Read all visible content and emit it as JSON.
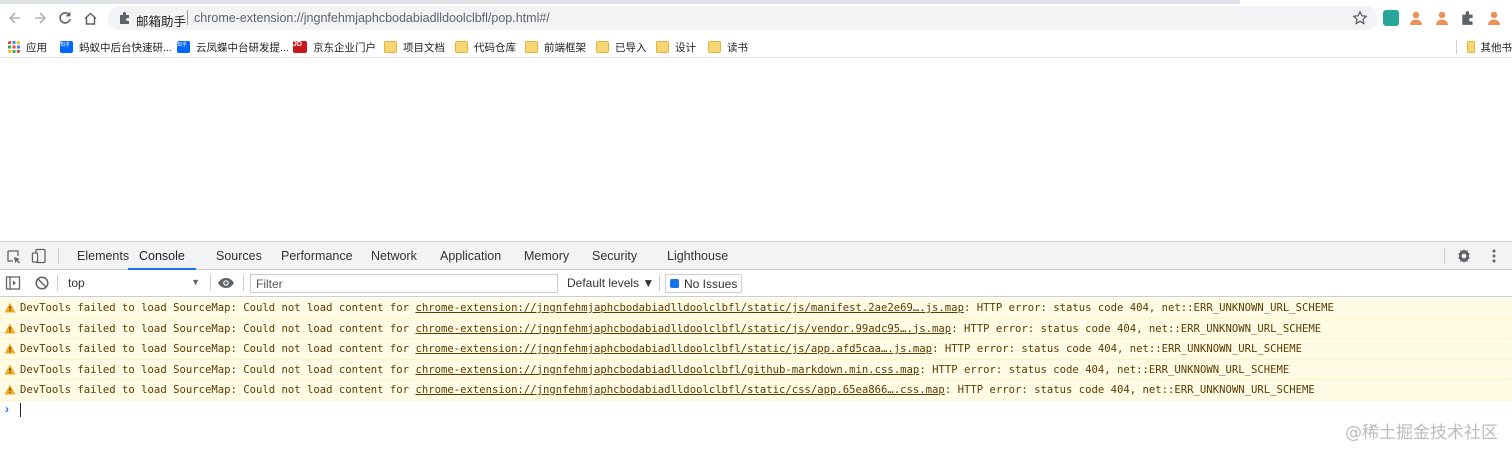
{
  "browser": {
    "site_name": "邮箱助手",
    "url": "chrome-extension://jngnfehmjaphcbodabiadlldoolclbfl/pop.html#/"
  },
  "bookmarks": [
    {
      "label": "应用",
      "icon": "apps-grid-icon"
    },
    {
      "label": "蚂蚁中后台快速研...",
      "icon": "zhihu-icon"
    },
    {
      "label": "云凤蝶中台研发提...",
      "icon": "zhihu-icon"
    },
    {
      "label": "京东企业门户",
      "icon": "jd-icon"
    },
    {
      "label": "项目文档",
      "icon": "folder-icon"
    },
    {
      "label": "代码仓库",
      "icon": "folder-icon"
    },
    {
      "label": "前端框架",
      "icon": "folder-icon"
    },
    {
      "label": "已导入",
      "icon": "folder-icon"
    },
    {
      "label": "设计",
      "icon": "folder-icon"
    },
    {
      "label": "读书",
      "icon": "folder-icon"
    },
    {
      "label": "其他书",
      "icon": "folder-icon"
    }
  ],
  "favicon_badges": {
    "zhihu": "知乎",
    "jd": "JD"
  },
  "devtools": {
    "tabs": [
      "Elements",
      "Console",
      "Sources",
      "Performance",
      "Network",
      "Application",
      "Memory",
      "Security",
      "Lighthouse"
    ],
    "active_tab": "Console",
    "context": "top",
    "filter_placeholder": "Filter",
    "levels_label": "Default levels ▼",
    "issues_label": "No Issues",
    "messages": [
      {
        "prefix": "DevTools failed to load SourceMap: Could not load content for ",
        "link": "chrome-extension://jngnfehmjaphcbodabiadlldoolclbfl/static/js/manifest.2ae2e69….js.map",
        "suffix": ": HTTP error: status code 404, net::ERR_UNKNOWN_URL_SCHEME"
      },
      {
        "prefix": "DevTools failed to load SourceMap: Could not load content for ",
        "link": "chrome-extension://jngnfehmjaphcbodabiadlldoolclbfl/static/js/vendor.99adc95….js.map",
        "suffix": ": HTTP error: status code 404, net::ERR_UNKNOWN_URL_SCHEME"
      },
      {
        "prefix": "DevTools failed to load SourceMap: Could not load content for ",
        "link": "chrome-extension://jngnfehmjaphcbodabiadlldoolclbfl/static/js/app.afd5caa….js.map",
        "suffix": ": HTTP error: status code 404, net::ERR_UNKNOWN_URL_SCHEME"
      },
      {
        "prefix": "DevTools failed to load SourceMap: Could not load content for ",
        "link": "chrome-extension://jngnfehmjaphcbodabiadlldoolclbfl/github-markdown.min.css.map",
        "suffix": ": HTTP error: status code 404, net::ERR_UNKNOWN_URL_SCHEME"
      },
      {
        "prefix": "DevTools failed to load SourceMap: Could not load content for ",
        "link": "chrome-extension://jngnfehmjaphcbodabiadlldoolclbfl/static/css/app.65ea866….css.map",
        "suffix": ": HTTP error: status code 404, net::ERR_UNKNOWN_URL_SCHEME"
      }
    ],
    "prompt_symbol": "›"
  },
  "watermark": "@稀土掘金技术社区",
  "colors": {
    "accent": "#1a73e8",
    "warning_bg": "#fffbe5",
    "warning_text": "#5c3c00",
    "warning_icon": "#f2ab26"
  }
}
